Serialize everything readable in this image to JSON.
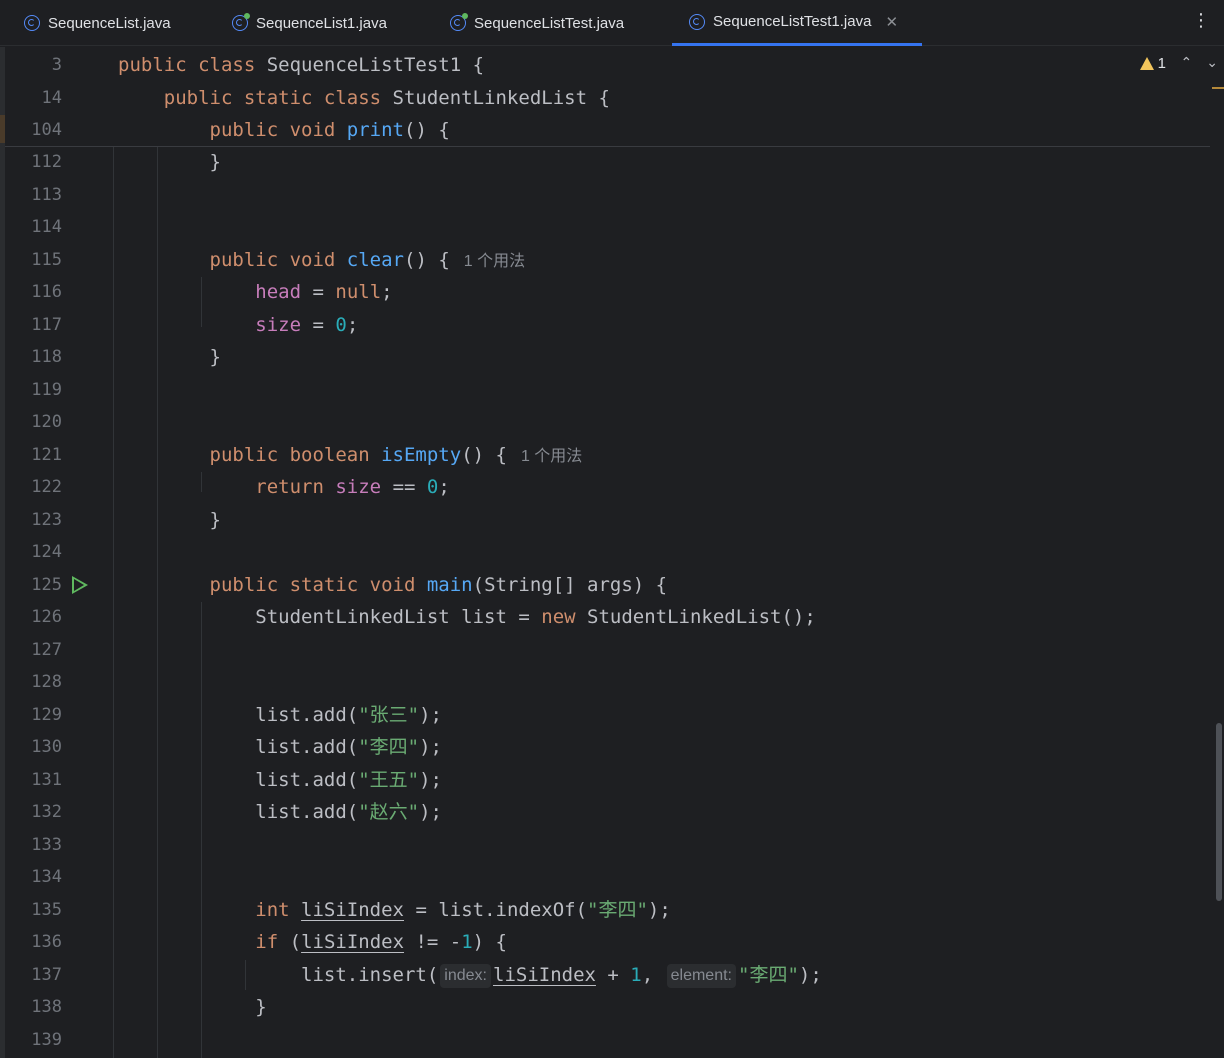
{
  "tabs": [
    {
      "label": "SequenceList.java",
      "active": false,
      "test": false
    },
    {
      "label": "SequenceList1.java",
      "active": false,
      "test": true
    },
    {
      "label": "SequenceListTest.java",
      "active": false,
      "test": true
    },
    {
      "label": "SequenceListTest1.java",
      "active": true,
      "test": false
    }
  ],
  "editor": {
    "warnings_count": "1",
    "sticky": [
      {
        "ln": "3",
        "code": "public class SequenceListTest1 {"
      },
      {
        "ln": "14",
        "code": "public static class StudentLinkedList {"
      },
      {
        "ln": "104",
        "code": "public void print() {"
      }
    ],
    "lines": [
      {
        "ln": "112"
      },
      {
        "ln": "113"
      },
      {
        "ln": "114"
      },
      {
        "ln": "115"
      },
      {
        "ln": "116"
      },
      {
        "ln": "117"
      },
      {
        "ln": "118"
      },
      {
        "ln": "119"
      },
      {
        "ln": "120"
      },
      {
        "ln": "121"
      },
      {
        "ln": "122"
      },
      {
        "ln": "123"
      },
      {
        "ln": "124"
      },
      {
        "ln": "125"
      },
      {
        "ln": "126"
      },
      {
        "ln": "127"
      },
      {
        "ln": "128"
      },
      {
        "ln": "129"
      },
      {
        "ln": "130"
      },
      {
        "ln": "131"
      },
      {
        "ln": "132"
      },
      {
        "ln": "133"
      },
      {
        "ln": "134"
      },
      {
        "ln": "135"
      },
      {
        "ln": "136"
      },
      {
        "ln": "137"
      },
      {
        "ln": "138"
      },
      {
        "ln": "139"
      }
    ],
    "usage_hint": "1 个用法",
    "param_hints": {
      "index": "index:",
      "element": "element:"
    },
    "names": {
      "zhangsan": "\"张三\"",
      "lisi": "\"李四\"",
      "wangwu": "\"王五\"",
      "zhaoliu": "\"赵六\""
    }
  },
  "colors": {
    "keyword": "#cf8e6d",
    "function": "#56a8f5",
    "field": "#c77dbb",
    "number": "#2aacb8",
    "string": "#6aab73",
    "tab_underline": "#3574f0"
  },
  "icons": [
    "java-class-icon",
    "java-test-class-icon",
    "close-icon",
    "more-options-icon",
    "warning-icon",
    "run-gutter-icon",
    "chevron-up-icon",
    "chevron-down-icon"
  ]
}
